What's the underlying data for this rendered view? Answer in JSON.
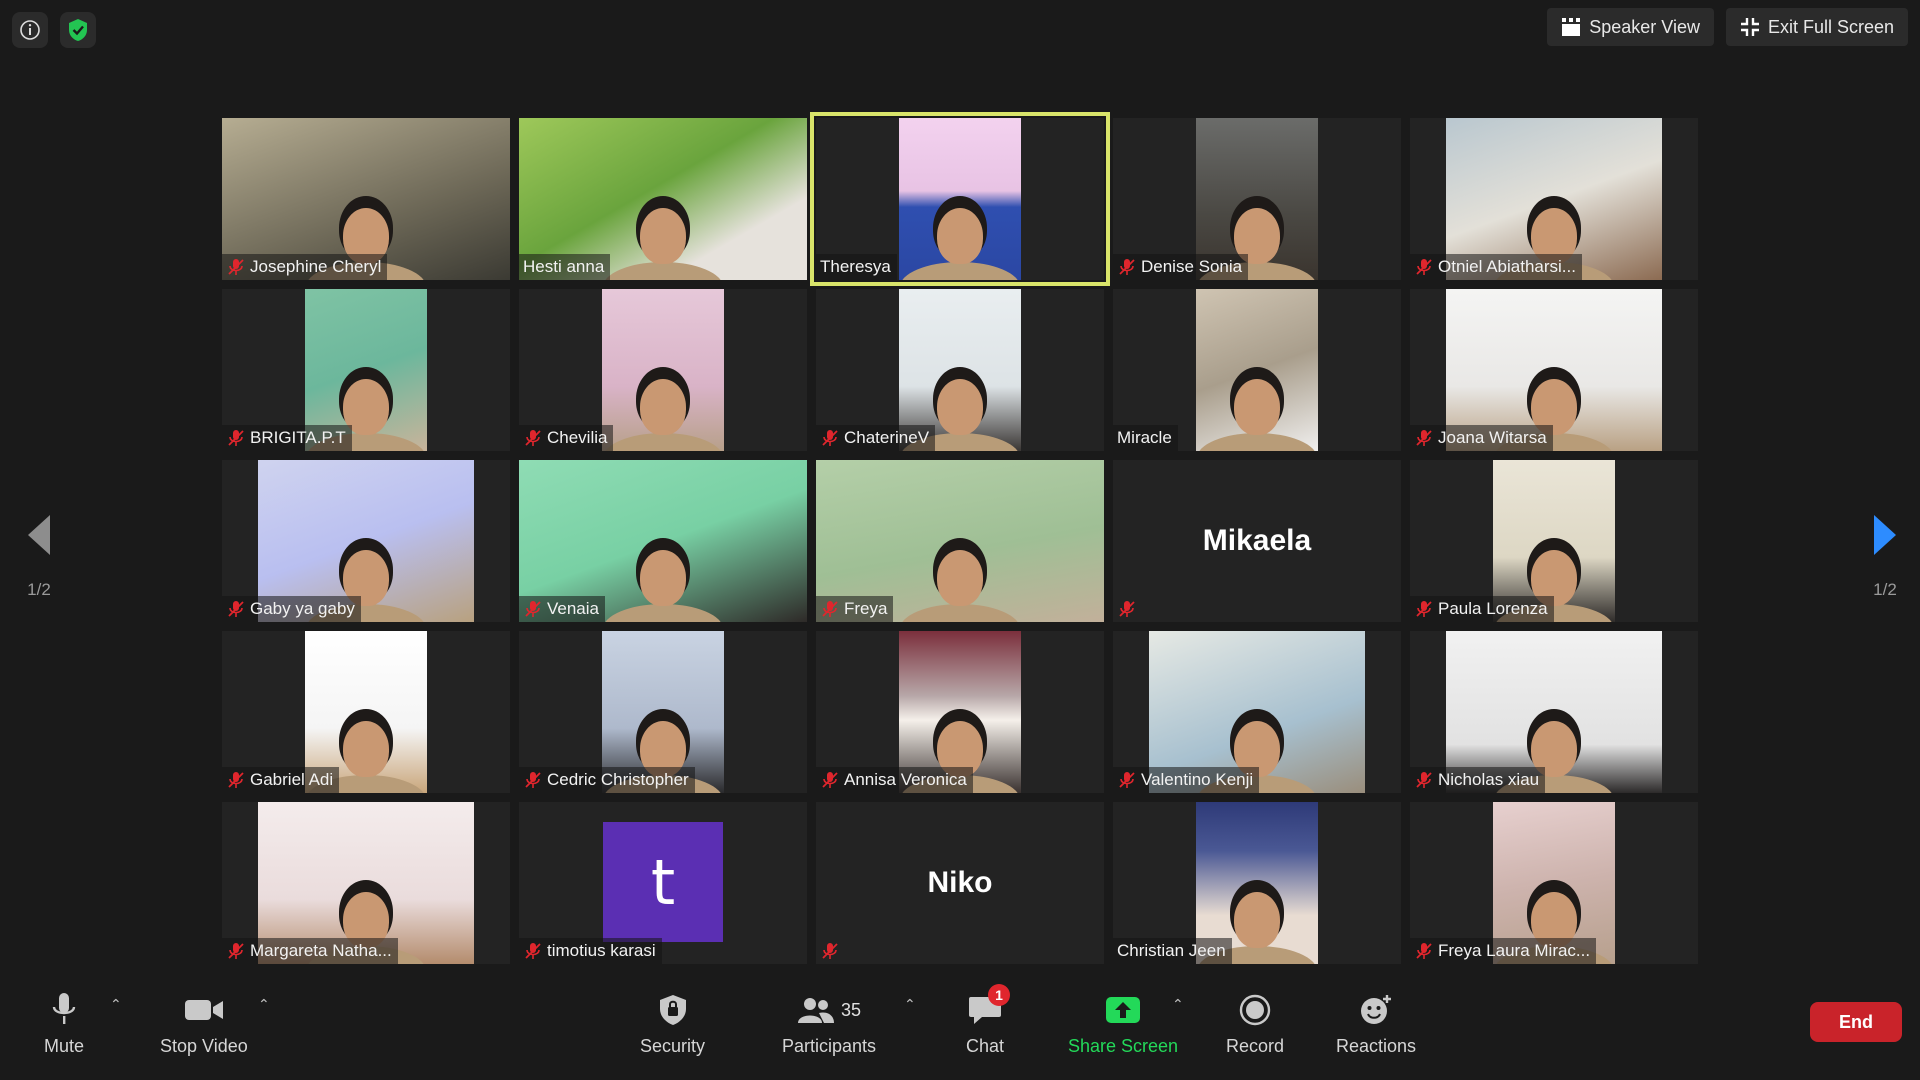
{
  "top": {
    "speaker_view_label": "Speaker View",
    "exit_fullscreen_label": "Exit Full Screen"
  },
  "pager": {
    "left_label": "1/2",
    "right_label": "1/2"
  },
  "tiles": [
    {
      "name": "Josephine Cheryl",
      "muted": true
    },
    {
      "name": "Hesti anna",
      "muted": false
    },
    {
      "name": "Theresya",
      "muted": false,
      "active": true
    },
    {
      "name": "Denise Sonia",
      "muted": true
    },
    {
      "name": "Otniel Abiatharsi...",
      "muted": true
    },
    {
      "name": "BRIGITA.P.T",
      "muted": true
    },
    {
      "name": "Chevilia",
      "muted": true
    },
    {
      "name": "ChaterineV",
      "muted": true
    },
    {
      "name": "Miracle",
      "muted": false
    },
    {
      "name": "Joana Witarsa",
      "muted": true
    },
    {
      "name": "Gaby ya gaby",
      "muted": true
    },
    {
      "name": "Venaia",
      "muted": true
    },
    {
      "name": "Freya",
      "muted": true
    },
    {
      "name": "Mikaela",
      "muted": true,
      "no_video": true
    },
    {
      "name": "Paula Lorenza",
      "muted": true
    },
    {
      "name": "Gabriel Adi",
      "muted": true
    },
    {
      "name": "Cedric Christopher",
      "muted": true
    },
    {
      "name": "Annisa Veronica",
      "muted": true
    },
    {
      "name": "Valentino Kenji",
      "muted": true
    },
    {
      "name": "Nicholas xiau",
      "muted": true
    },
    {
      "name": "Margareta Natha...",
      "muted": true
    },
    {
      "name": "timotius karasi",
      "muted": true,
      "avatar_letter": "t"
    },
    {
      "name": "Niko",
      "muted": true,
      "no_video": true
    },
    {
      "name": "Christian Jeen",
      "muted": false
    },
    {
      "name": "Freya Laura Mirac...",
      "muted": true
    }
  ],
  "toolbar": {
    "mute_label": "Mute",
    "stop_video_label": "Stop Video",
    "security_label": "Security",
    "participants_label": "Participants",
    "participants_count": "35",
    "chat_label": "Chat",
    "chat_badge": "1",
    "share_screen_label": "Share Screen",
    "record_label": "Record",
    "reactions_label": "Reactions",
    "end_label": "End"
  },
  "colors": {
    "background": "#1a1a1a",
    "active_speaker_border": "#d9e46a",
    "share_screen_green": "#23d959",
    "end_red": "#c9232a",
    "muted_icon_red": "#e0262d"
  }
}
